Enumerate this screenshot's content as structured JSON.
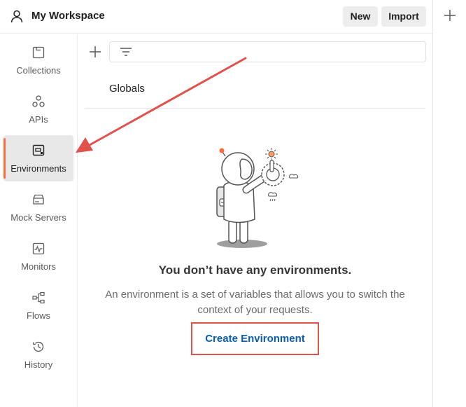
{
  "header": {
    "workspace_title": "My Workspace",
    "new_label": "New",
    "import_label": "Import",
    "user_icon": "user-icon",
    "new_tab_icon": "plus-icon"
  },
  "sidebar": {
    "items": [
      {
        "label": "Collections",
        "icon": "collections-icon",
        "active": false
      },
      {
        "label": "APIs",
        "icon": "apis-icon",
        "active": false
      },
      {
        "label": "Environments",
        "icon": "environments-icon",
        "active": true
      },
      {
        "label": "Mock Servers",
        "icon": "mock-servers-icon",
        "active": false
      },
      {
        "label": "Monitors",
        "icon": "monitors-icon",
        "active": false
      },
      {
        "label": "Flows",
        "icon": "flows-icon",
        "active": false
      },
      {
        "label": "History",
        "icon": "history-icon",
        "active": false
      }
    ]
  },
  "list": {
    "globals_label": "Globals"
  },
  "empty_state": {
    "title": "You don’t have any environments.",
    "description": "An environment is a set of variables that allows you to switch the context of your requests.",
    "create_label": "Create Environment"
  },
  "colors": {
    "accent": "#ff6c37",
    "link": "#0b5cad",
    "highlight_box": "#d9534f",
    "annotation_arrow": "#e2504a"
  }
}
